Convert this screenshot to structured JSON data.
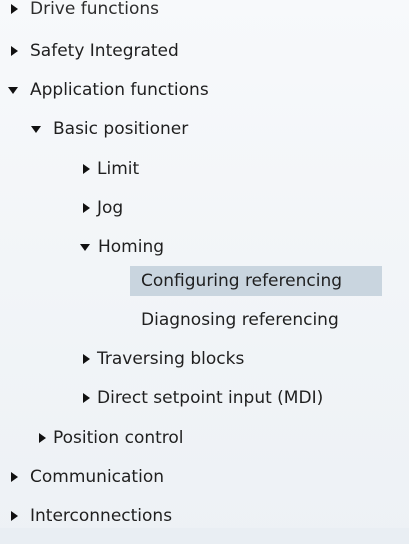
{
  "tree": {
    "items": [
      {
        "label": "Drive functions",
        "icon": "expand-arrow-right-icon"
      },
      {
        "label": "Safety Integrated",
        "icon": "expand-arrow-right-icon"
      },
      {
        "label": "Application functions",
        "icon": "collapse-arrow-down-icon"
      },
      {
        "label": "Basic positioner",
        "icon": "collapse-arrow-down-icon"
      },
      {
        "label": "Limit",
        "icon": "expand-arrow-right-icon"
      },
      {
        "label": "Jog",
        "icon": "expand-arrow-right-icon"
      },
      {
        "label": "Homing",
        "icon": "collapse-arrow-down-icon"
      },
      {
        "label": "Configuring referencing",
        "selected": true
      },
      {
        "label": "Diagnosing referencing"
      },
      {
        "label": "Traversing blocks",
        "icon": "expand-arrow-right-icon"
      },
      {
        "label": "Direct setpoint input (MDI)",
        "icon": "expand-arrow-right-icon"
      },
      {
        "label": "Position control",
        "icon": "expand-arrow-right-icon"
      },
      {
        "label": "Communication",
        "icon": "expand-arrow-right-icon"
      },
      {
        "label": "Interconnections",
        "icon": "expand-arrow-right-icon"
      }
    ]
  },
  "colors": {
    "background": "#eef2f6",
    "selection": "#c9d5df",
    "text": "#1f1f1f",
    "arrow": "#111111"
  }
}
